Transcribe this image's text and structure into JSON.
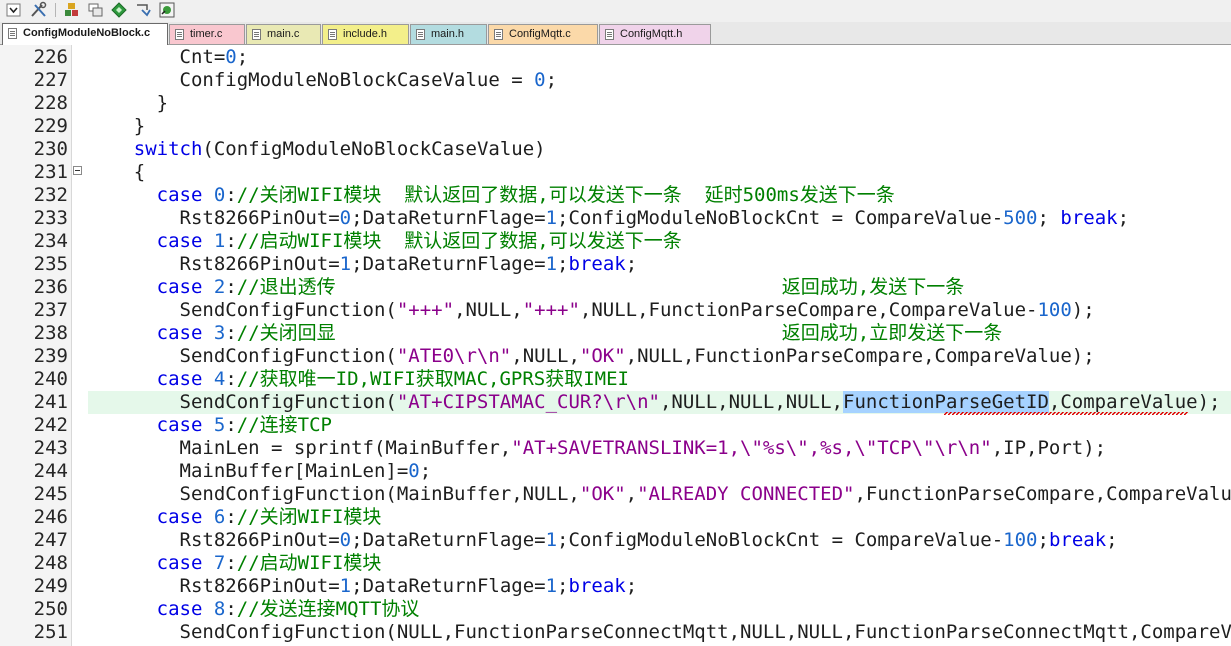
{
  "toolbar": {
    "buttons": [
      "chevron-down-icon",
      "tools-icon",
      "build-icon",
      "window-icon",
      "diamond-icon",
      "download-icon",
      "target-icon"
    ]
  },
  "tabs": [
    {
      "label": "ConfigModuleNoBlock.c",
      "color": "#ffffff",
      "active": true
    },
    {
      "label": "timer.c",
      "color": "#f9c7cf"
    },
    {
      "label": "main.c",
      "color": "#e9e9b4"
    },
    {
      "label": "include.h",
      "color": "#f3ef8a"
    },
    {
      "label": "main.h",
      "color": "#b3dce0"
    },
    {
      "label": "ConfigMqtt.c",
      "color": "#fbd9a9"
    },
    {
      "label": "ConfigMqtt.h",
      "color": "#f0d3ea"
    }
  ],
  "editor": {
    "selected_text": "FunctionParseGetID",
    "highlighted_line": "241",
    "lines": [
      {
        "n": "226",
        "segs": [
          [
            "p",
            "        Cnt="
          ],
          [
            "num",
            "0"
          ],
          [
            "p",
            ";"
          ]
        ]
      },
      {
        "n": "227",
        "segs": [
          [
            "p",
            "        ConfigModuleNoBlockCaseValue = "
          ],
          [
            "num",
            "0"
          ],
          [
            "p",
            ";"
          ]
        ]
      },
      {
        "n": "228",
        "segs": [
          [
            "p",
            "      }"
          ]
        ]
      },
      {
        "n": "229",
        "segs": [
          [
            "p",
            "    }"
          ]
        ]
      },
      {
        "n": "230",
        "segs": [
          [
            "p",
            "    "
          ],
          [
            "kw",
            "switch"
          ],
          [
            "p",
            "(ConfigModuleNoBlockCaseValue)"
          ]
        ]
      },
      {
        "n": "231",
        "fold": true,
        "segs": [
          [
            "p",
            "    {"
          ]
        ]
      },
      {
        "n": "232",
        "segs": [
          [
            "p",
            "      "
          ],
          [
            "kw",
            "case"
          ],
          [
            "p",
            " "
          ],
          [
            "num",
            "0"
          ],
          [
            "p",
            ":"
          ],
          [
            "cm",
            "//关闭WIFI模块  默认返回了数据,可以发送下一条  延时500ms发送下一条"
          ]
        ]
      },
      {
        "n": "233",
        "segs": [
          [
            "p",
            "        Rst8266PinOut="
          ],
          [
            "num",
            "0"
          ],
          [
            "p",
            ";DataReturnFlage="
          ],
          [
            "num",
            "1"
          ],
          [
            "p",
            ";ConfigModuleNoBlockCnt = CompareValue-"
          ],
          [
            "num",
            "500"
          ],
          [
            "p",
            "; "
          ],
          [
            "kw",
            "break"
          ],
          [
            "p",
            ";"
          ]
        ]
      },
      {
        "n": "234",
        "segs": [
          [
            "p",
            "      "
          ],
          [
            "kw",
            "case"
          ],
          [
            "p",
            " "
          ],
          [
            "num",
            "1"
          ],
          [
            "p",
            ":"
          ],
          [
            "cm",
            "//启动WIFI模块  默认返回了数据,可以发送下一条"
          ]
        ]
      },
      {
        "n": "235",
        "segs": [
          [
            "p",
            "        Rst8266PinOut="
          ],
          [
            "num",
            "1"
          ],
          [
            "p",
            ";DataReturnFlage="
          ],
          [
            "num",
            "1"
          ],
          [
            "p",
            ";"
          ],
          [
            "kw",
            "break"
          ],
          [
            "p",
            ";"
          ]
        ]
      },
      {
        "n": "236",
        "segs": [
          [
            "p",
            "      "
          ],
          [
            "kw",
            "case"
          ],
          [
            "p",
            " "
          ],
          [
            "num",
            "2"
          ],
          [
            "p",
            ":"
          ],
          [
            "cm",
            "//退出透传                                       返回成功,发送下一条"
          ]
        ]
      },
      {
        "n": "237",
        "segs": [
          [
            "p",
            "        SendConfigFunction("
          ],
          [
            "str",
            "\"+++\""
          ],
          [
            "p",
            ",NULL,"
          ],
          [
            "str",
            "\"+++\""
          ],
          [
            "p",
            ",NULL,FunctionParseCompare,CompareValue-"
          ],
          [
            "num",
            "100"
          ],
          [
            "p",
            ");"
          ]
        ]
      },
      {
        "n": "238",
        "segs": [
          [
            "p",
            "      "
          ],
          [
            "kw",
            "case"
          ],
          [
            "p",
            " "
          ],
          [
            "num",
            "3"
          ],
          [
            "p",
            ":"
          ],
          [
            "cm",
            "//关闭回显                                       返回成功,立即发送下一条"
          ]
        ]
      },
      {
        "n": "239",
        "segs": [
          [
            "p",
            "        SendConfigFunction("
          ],
          [
            "str",
            "\"ATE0\\r\\n\""
          ],
          [
            "p",
            ",NULL,"
          ],
          [
            "str",
            "\"OK\""
          ],
          [
            "p",
            ",NULL,FunctionParseCompare,CompareValue);"
          ]
        ]
      },
      {
        "n": "240",
        "segs": [
          [
            "p",
            "      "
          ],
          [
            "kw",
            "case"
          ],
          [
            "p",
            " "
          ],
          [
            "num",
            "4"
          ],
          [
            "p",
            ":"
          ],
          [
            "cm",
            "//获取唯一ID,WIFI获取MAC,GPRS获取IMEI"
          ]
        ]
      },
      {
        "n": "241",
        "segs": [
          [
            "p",
            "        SendConfigFunction("
          ],
          [
            "str",
            "\"AT+CIPSTAMAC_CUR?\\r\\n\""
          ],
          [
            "p",
            ",NULL,NULL,NULL,"
          ],
          [
            "sel",
            "FunctionParseGetID"
          ],
          [
            "p",
            ",CompareValue);"
          ]
        ]
      },
      {
        "n": "242",
        "segs": [
          [
            "p",
            "      "
          ],
          [
            "kw",
            "case"
          ],
          [
            "p",
            " "
          ],
          [
            "num",
            "5"
          ],
          [
            "p",
            ":"
          ],
          [
            "cm",
            "//连接TCP"
          ]
        ]
      },
      {
        "n": "243",
        "segs": [
          [
            "p",
            "        MainLen = sprintf(MainBuffer,"
          ],
          [
            "str",
            "\"AT+SAVETRANSLINK=1,\\\"%s\\\",%s,\\\"TCP\\\"\\r\\n\""
          ],
          [
            "p",
            ",IP,Port);"
          ]
        ]
      },
      {
        "n": "244",
        "segs": [
          [
            "p",
            "        MainBuffer[MainLen]="
          ],
          [
            "num",
            "0"
          ],
          [
            "p",
            ";"
          ]
        ]
      },
      {
        "n": "245",
        "segs": [
          [
            "p",
            "        SendConfigFunction(MainBuffer,NULL,"
          ],
          [
            "str",
            "\"OK\""
          ],
          [
            "p",
            ","
          ],
          [
            "str",
            "\"ALREADY CONNECTED\""
          ],
          [
            "p",
            ",FunctionParseCompare,CompareValue);"
          ]
        ]
      },
      {
        "n": "246",
        "segs": [
          [
            "p",
            "      "
          ],
          [
            "kw",
            "case"
          ],
          [
            "p",
            " "
          ],
          [
            "num",
            "6"
          ],
          [
            "p",
            ":"
          ],
          [
            "cm",
            "//关闭WIFI模块"
          ]
        ]
      },
      {
        "n": "247",
        "segs": [
          [
            "p",
            "        Rst8266PinOut="
          ],
          [
            "num",
            "0"
          ],
          [
            "p",
            ";DataReturnFlage="
          ],
          [
            "num",
            "1"
          ],
          [
            "p",
            ";ConfigModuleNoBlockCnt = CompareValue-"
          ],
          [
            "num",
            "100"
          ],
          [
            "p",
            ";"
          ],
          [
            "kw",
            "break"
          ],
          [
            "p",
            ";"
          ]
        ]
      },
      {
        "n": "248",
        "segs": [
          [
            "p",
            "      "
          ],
          [
            "kw",
            "case"
          ],
          [
            "p",
            " "
          ],
          [
            "num",
            "7"
          ],
          [
            "p",
            ":"
          ],
          [
            "cm",
            "//启动WIFI模块"
          ]
        ]
      },
      {
        "n": "249",
        "segs": [
          [
            "p",
            "        Rst8266PinOut="
          ],
          [
            "num",
            "1"
          ],
          [
            "p",
            ";DataReturnFlage="
          ],
          [
            "num",
            "1"
          ],
          [
            "p",
            ";"
          ],
          [
            "kw",
            "break"
          ],
          [
            "p",
            ";"
          ]
        ]
      },
      {
        "n": "250",
        "segs": [
          [
            "p",
            "      "
          ],
          [
            "kw",
            "case"
          ],
          [
            "p",
            " "
          ],
          [
            "num",
            "8"
          ],
          [
            "p",
            ":"
          ],
          [
            "cm",
            "//发送连接MQTT协议"
          ]
        ]
      },
      {
        "n": "251",
        "segs": [
          [
            "p",
            "        SendConfigFunction(NULL,FunctionParseConnectMqtt,NULL,NULL,FunctionParseConnectMqtt,CompareValue);"
          ]
        ]
      }
    ]
  }
}
